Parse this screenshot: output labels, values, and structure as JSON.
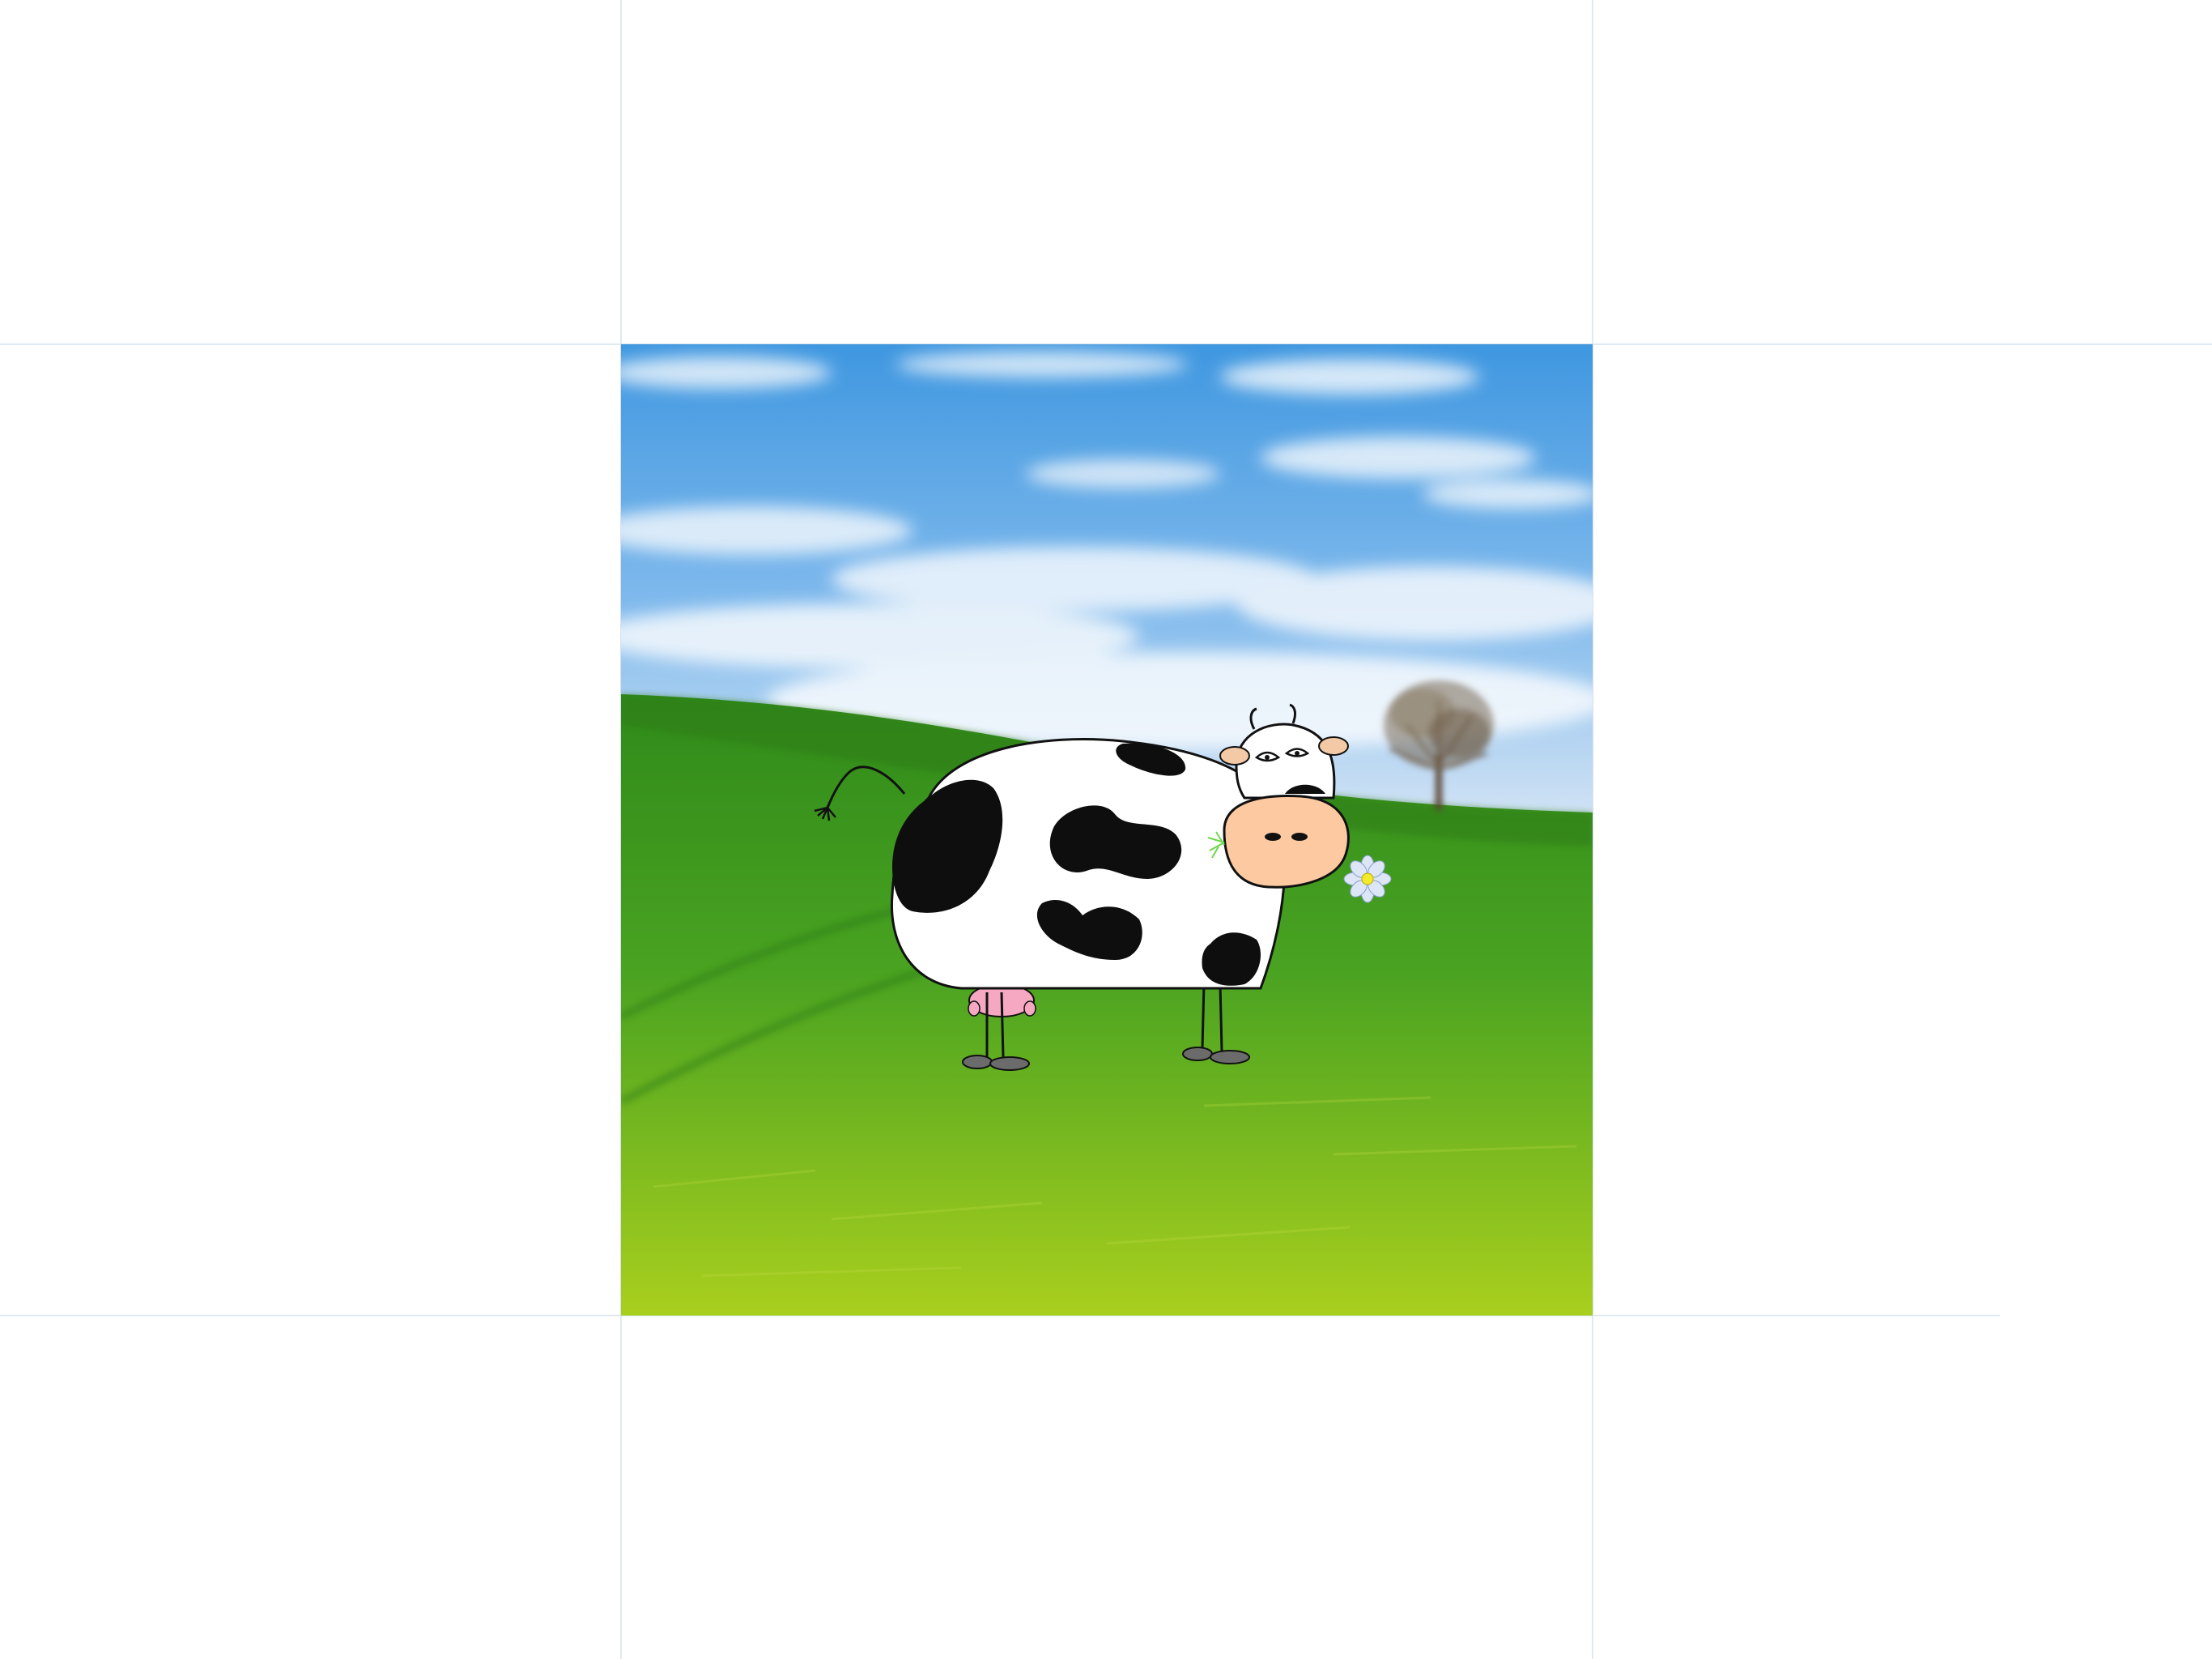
{
  "canvas": {
    "background_color": "#ffffff",
    "guide_color": "#dfeaf3"
  },
  "artboard": {
    "scene": {
      "sky_colors": [
        "#3f97e0",
        "#7fb9ec",
        "#dfeaf6"
      ],
      "grass_colors": [
        "#2f8a1a",
        "#4aa321",
        "#a9cf1e"
      ],
      "icons": [
        "tree-icon",
        "cow-icon",
        "flower-icon"
      ]
    }
  }
}
